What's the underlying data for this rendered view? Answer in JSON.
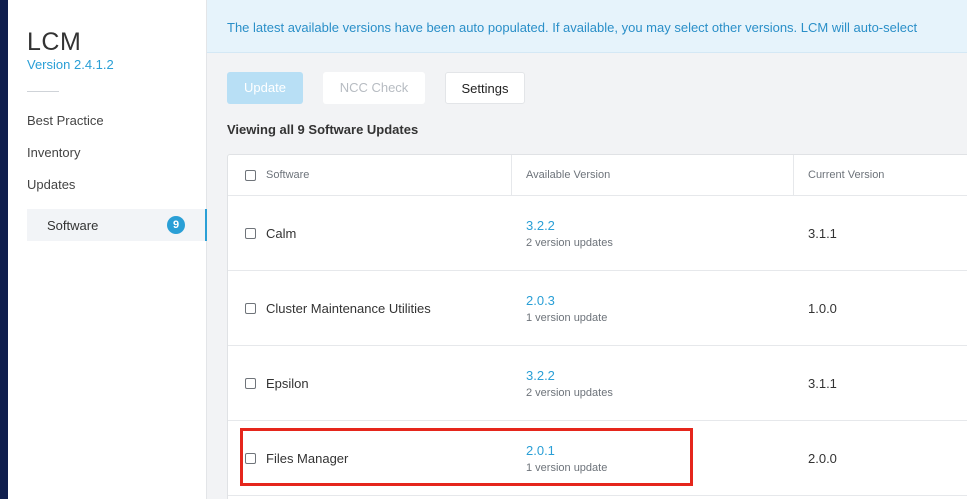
{
  "sidebar": {
    "app_title": "LCM",
    "version": "Version 2.4.1.2",
    "nav": {
      "best_practice": "Best Practice",
      "inventory": "Inventory",
      "updates": "Updates",
      "software": "Software",
      "software_badge": "9"
    }
  },
  "banner": {
    "text": "The latest available versions have been auto populated. If available, you may select other versions. LCM will auto-select"
  },
  "toolbar": {
    "update_label": "Update",
    "ncc_label": "NCC Check",
    "settings_label": "Settings"
  },
  "main": {
    "viewing_title": "Viewing all 9 Software Updates"
  },
  "table": {
    "headers": {
      "software": "Software",
      "available": "Available Version",
      "current": "Current Version"
    },
    "rows": [
      {
        "name": "Calm",
        "available": "3.2.2",
        "available_sub": "2 version updates",
        "current": "3.1.1"
      },
      {
        "name": "Cluster Maintenance Utilities",
        "available": "2.0.3",
        "available_sub": "1 version update",
        "current": "1.0.0"
      },
      {
        "name": "Epsilon",
        "available": "3.2.2",
        "available_sub": "2 version updates",
        "current": "3.1.1"
      },
      {
        "name": "Files Manager",
        "available": "2.0.1",
        "available_sub": "1 version update",
        "current": "2.0.0"
      }
    ]
  },
  "colors": {
    "accent": "#2a9fd6",
    "highlight_box": "#e5261c",
    "banner_bg": "#e6f3fb"
  }
}
